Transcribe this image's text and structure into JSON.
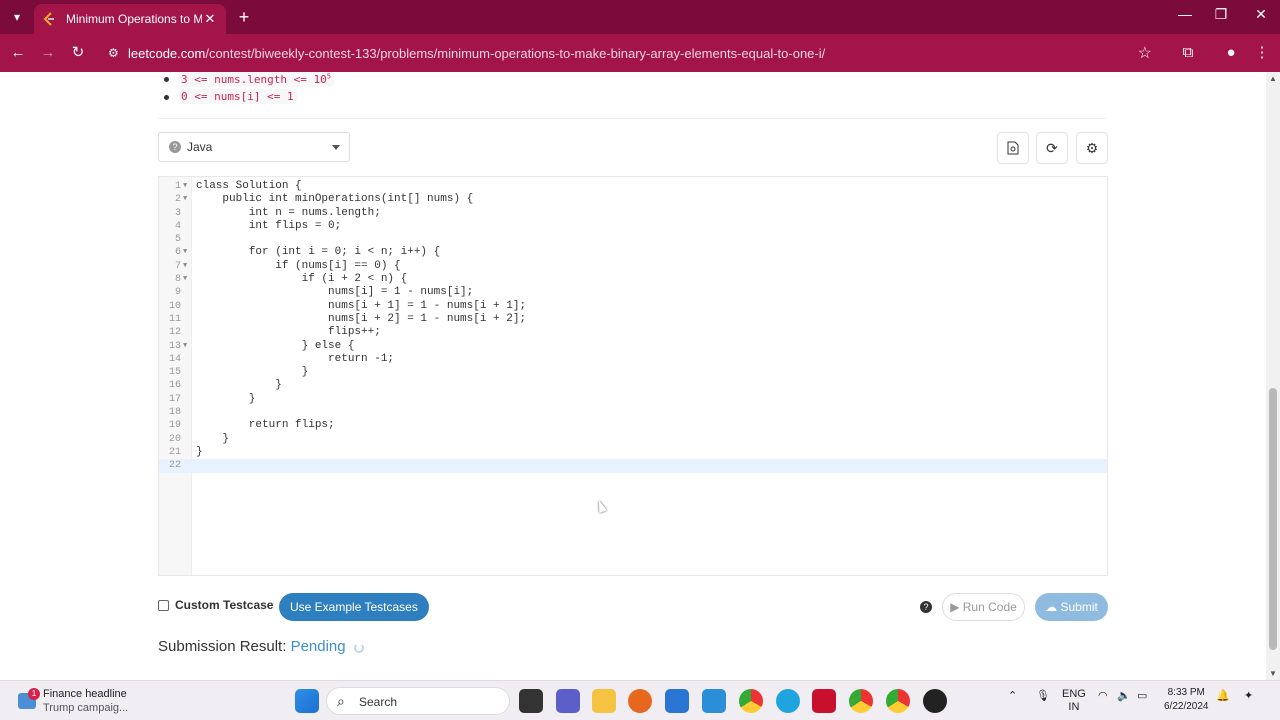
{
  "browser": {
    "tab_title": "Minimum Operations to Make Binary Array Elements Equal to One I",
    "url_domain": "leetcode.com",
    "url_path": "/contest/biweekly-contest-133/problems/minimum-operations-to-make-binary-array-elements-equal-to-one-i/"
  },
  "constraints": [
    "3 <= nums.length <= 10",
    "0 <= nums[i] <= 1"
  ],
  "constraint_superscript": "5",
  "editor": {
    "language": "Java",
    "line_numbers": [
      "1",
      "2",
      "3",
      "4",
      "5",
      "6",
      "7",
      "8",
      "9",
      "10",
      "11",
      "12",
      "13",
      "14",
      "15",
      "16",
      "17",
      "18",
      "19",
      "20",
      "21",
      "22"
    ],
    "code_lines": [
      "class Solution {",
      "    public int minOperations(int[] nums) {",
      "        int n = nums.length;",
      "        int flips = 0;",
      "",
      "        for (int i = 0; i < n; i++) {",
      "            if (nums[i] == 0) {",
      "                if (i + 2 < n) {",
      "                    nums[i] = 1 - nums[i];",
      "                    nums[i + 1] = 1 - nums[i + 1];",
      "                    nums[i + 2] = 1 - nums[i + 2];",
      "                    flips++;",
      "                } else {",
      "                    return -1;",
      "                }",
      "            }",
      "        }",
      "",
      "        return flips;",
      "    }",
      "}",
      ""
    ]
  },
  "actions": {
    "custom_testcase_label": "Custom Testcase",
    "example_testcases_label": "Use Example Testcases",
    "run_code_label": "Run Code",
    "submit_label": "Submit"
  },
  "result": {
    "label": "Submission Result:",
    "status": "Pending"
  },
  "taskbar": {
    "news_headline": "Finance headline",
    "news_sub": "Trump campaig...",
    "news_badge": "1",
    "search_label": "Search",
    "lang_top": "ENG",
    "lang_bottom": "IN",
    "time": "8:33 PM",
    "date": "6/22/2024"
  },
  "colors": {
    "browser_frame": "#7a0b3a",
    "browser_toolbar": "#a31548",
    "accent_blue": "#2e7fbf",
    "pending_blue": "#3b8fcf"
  }
}
